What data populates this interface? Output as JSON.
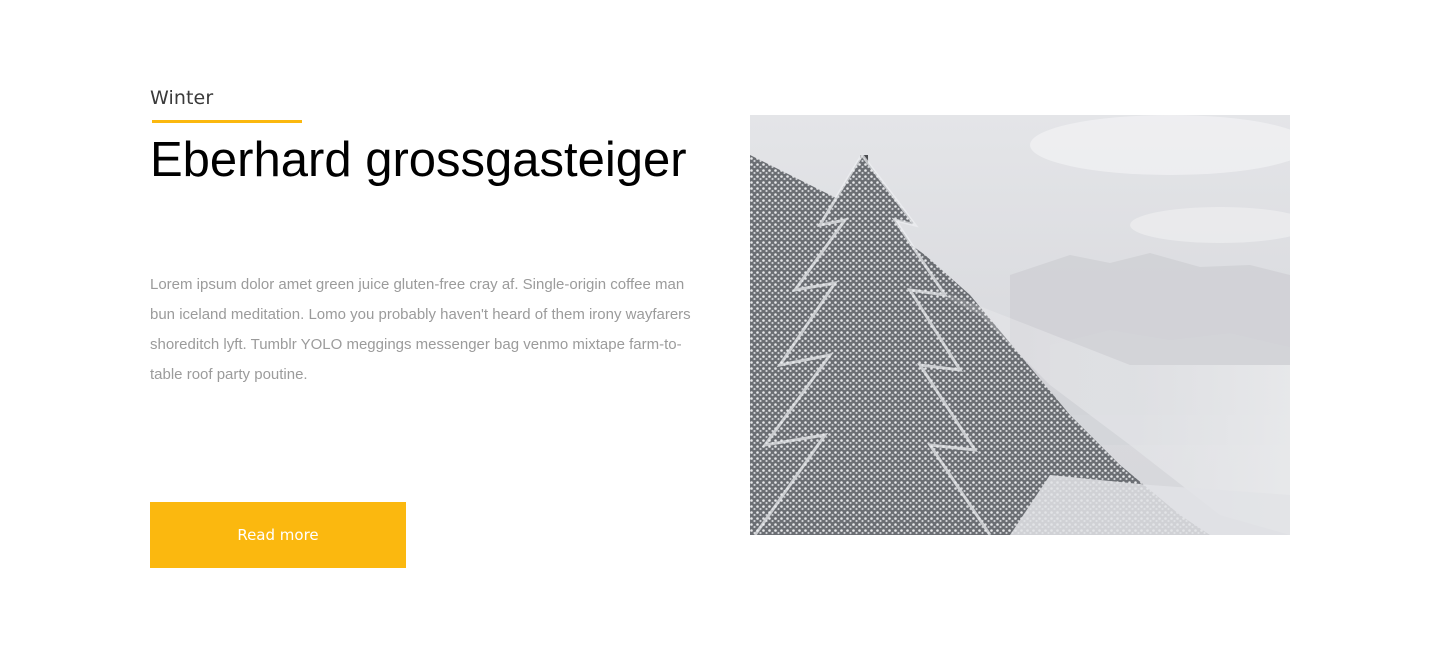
{
  "post": {
    "category": "Winter",
    "title": "Eberhard grossgasteiger",
    "description": "Lorem ipsum dolor amet green juice gluten-free cray af. Single-origin coffee man bun iceland meditation. Lomo you probably haven't heard of them irony wayfarers shoreditch lyft. Tumblr YOLO meggings messenger bag venmo mixtape farm-to-table roof party poutine.",
    "button_label": "Read more",
    "image_subject": "snowy-forest-mountain-photo"
  },
  "colors": {
    "accent": "#fbb80f",
    "title": "#000000",
    "body_text": "#9b9b9b",
    "category_text": "#3a3a3a",
    "button_text": "#ffffff"
  }
}
